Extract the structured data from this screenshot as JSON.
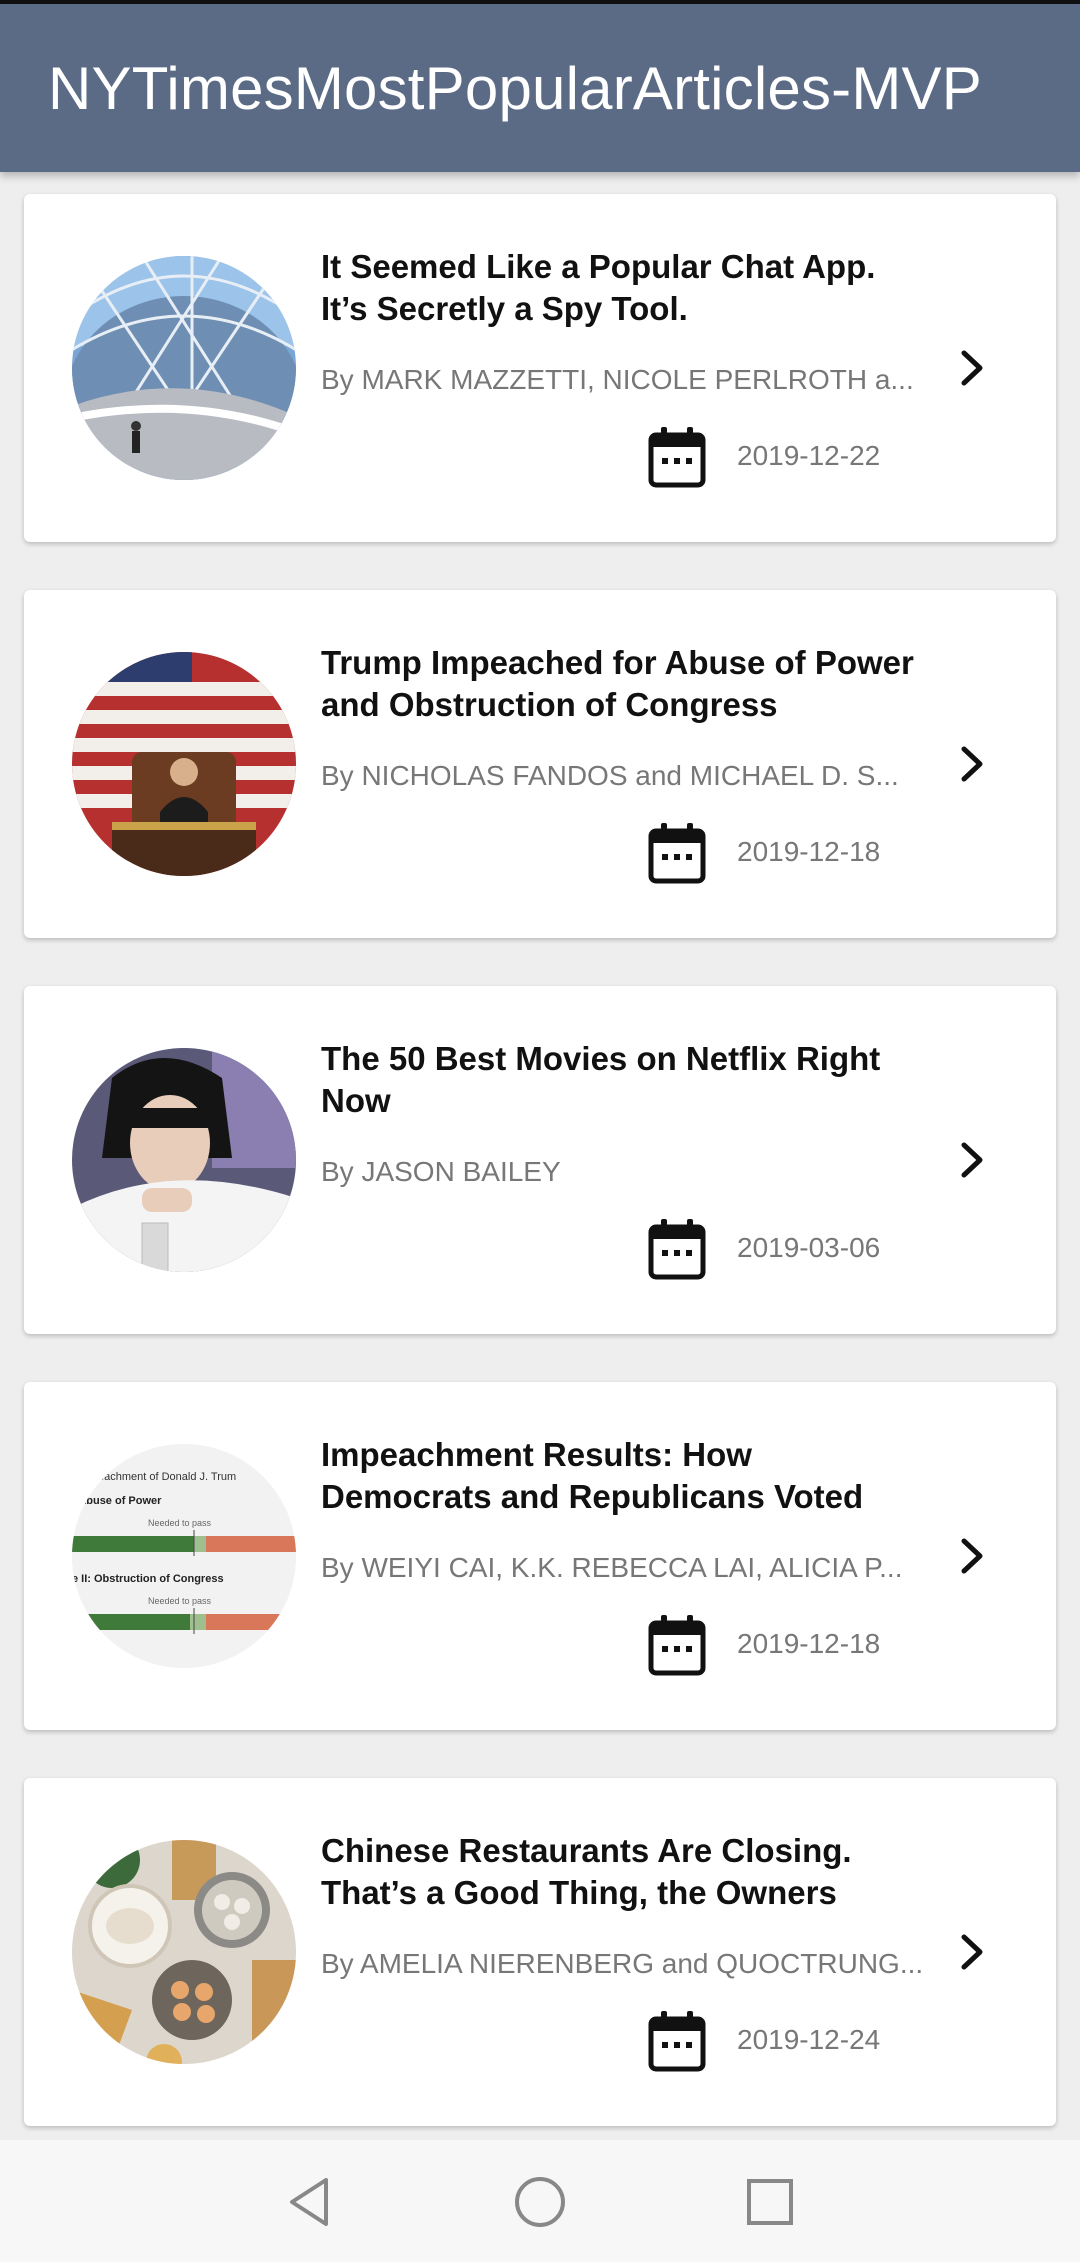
{
  "app_bar": {
    "title": "NYTimesMostPopularArticles-MVP"
  },
  "articles": [
    {
      "title": "It Seemed Like a Popular Chat App. It’s Secretly a Spy Tool.",
      "byline": "By MARK MAZZETTI, NICOLE PERLROTH a...",
      "date": "2019-12-22",
      "thumbnail": "glass-dome-building-photo"
    },
    {
      "title": "Trump Impeached for Abuse of Power and Obstruction of Congress",
      "byline": "By NICHOLAS FANDOS and MICHAEL D. S...",
      "date": "2019-12-18",
      "thumbnail": "house-speaker-flag-photo"
    },
    {
      "title": "The 50 Best Movies on Netflix Right Now",
      "byline": "By JASON BAILEY",
      "date": "2019-03-06",
      "thumbnail": "movie-still-photo"
    },
    {
      "title": "Impeachment Results: How Democrats and Republicans Voted",
      "byline": "By WEIYI CAI, K.K. REBECCA LAI, ALICIA P...",
      "date": "2019-12-18",
      "thumbnail": "vote-chart-graphic",
      "thumbnail_text": {
        "line1": "eachment of Donald J. Trum",
        "line2": ": Abuse of Power",
        "line3": "Needed to pass",
        "line4": "e II: Obstruction of Congress",
        "line5": "Needed to pass"
      }
    },
    {
      "title": "Chinese Restaurants Are Closing. That’s a Good Thing, the Owners",
      "byline": "By AMELIA NIERENBERG and QUOCTRUNG...",
      "date": "2019-12-24",
      "thumbnail": "dim-sum-food-photo"
    }
  ],
  "icons": {
    "date": "calendar-icon",
    "open": "chevron-right-icon",
    "nav_back": "back-triangle-icon",
    "nav_home": "home-circle-icon",
    "nav_recents": "recents-square-icon"
  },
  "colors": {
    "app_bar": "#5b6b85",
    "card_bg": "#ffffff",
    "page_bg": "#eeeeee",
    "title_text": "#111111",
    "meta_text": "#777777"
  }
}
